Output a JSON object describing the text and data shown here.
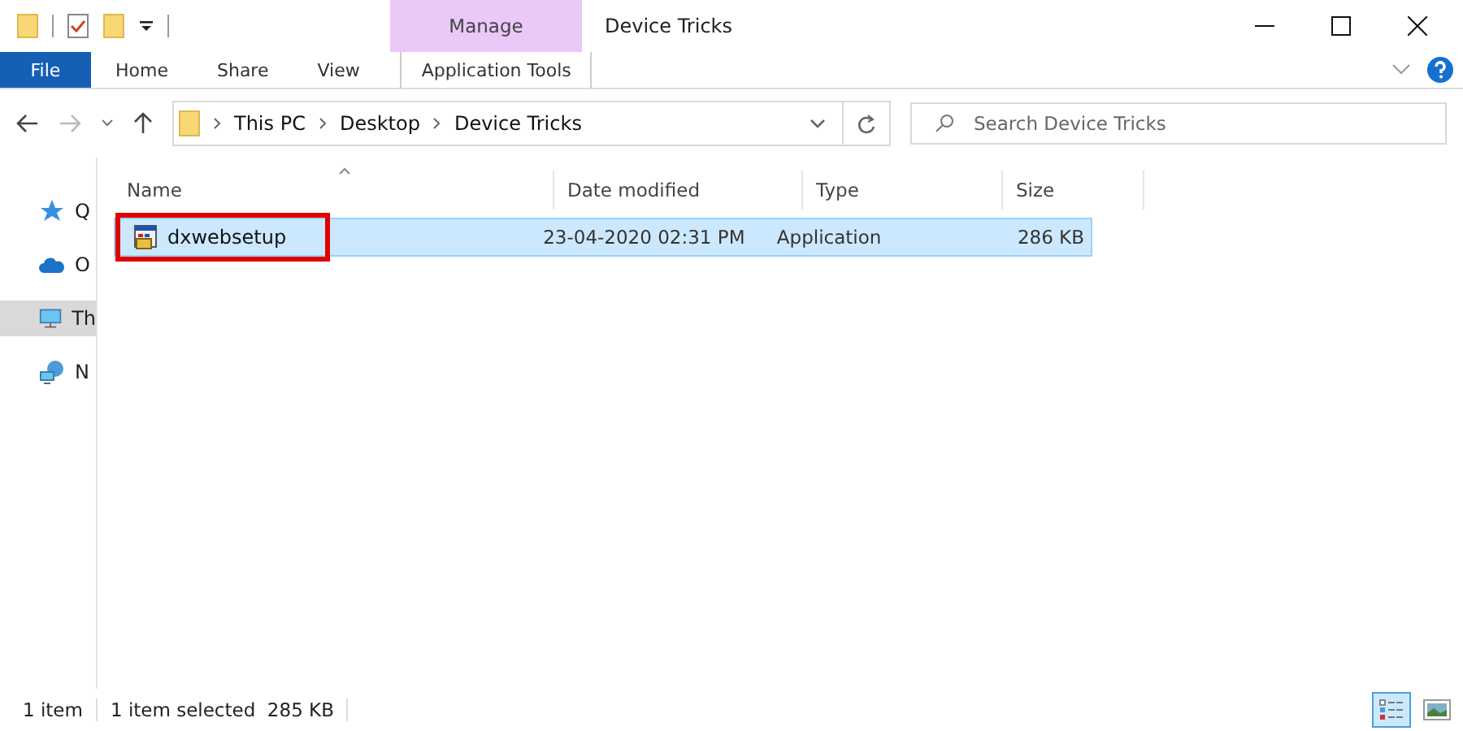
{
  "window": {
    "title": "Device Tricks"
  },
  "context_tab": {
    "group": "Manage",
    "label": "Application Tools"
  },
  "ribbon_tabs": [
    {
      "label": "File",
      "kind": "file",
      "selected": false
    },
    {
      "label": "Home",
      "kind": "tab",
      "selected": false
    },
    {
      "label": "Share",
      "kind": "tab",
      "selected": false
    },
    {
      "label": "View",
      "kind": "tab",
      "selected": false
    }
  ],
  "breadcrumb": [
    "This PC",
    "Desktop",
    "Device Tricks"
  ],
  "search": {
    "placeholder": "Search Device Tricks"
  },
  "sidebar": {
    "items": [
      {
        "label": "Q",
        "kind": "star",
        "selected": false
      },
      {
        "label": "O",
        "kind": "cloud",
        "selected": false
      },
      {
        "label": "Th",
        "kind": "pc",
        "selected": true
      },
      {
        "label": "N",
        "kind": "network",
        "selected": false
      }
    ]
  },
  "table": {
    "columns": [
      "Name",
      "Date modified",
      "Type",
      "Size"
    ],
    "rows": [
      {
        "name": "dxwebsetup",
        "date": "23-04-2020 02:31 PM",
        "type": "Application",
        "size": "286 KB",
        "selected": true,
        "highlighted": true
      }
    ]
  },
  "status_bar": {
    "count": "1 item",
    "selection": "1 item selected  285 KB"
  }
}
